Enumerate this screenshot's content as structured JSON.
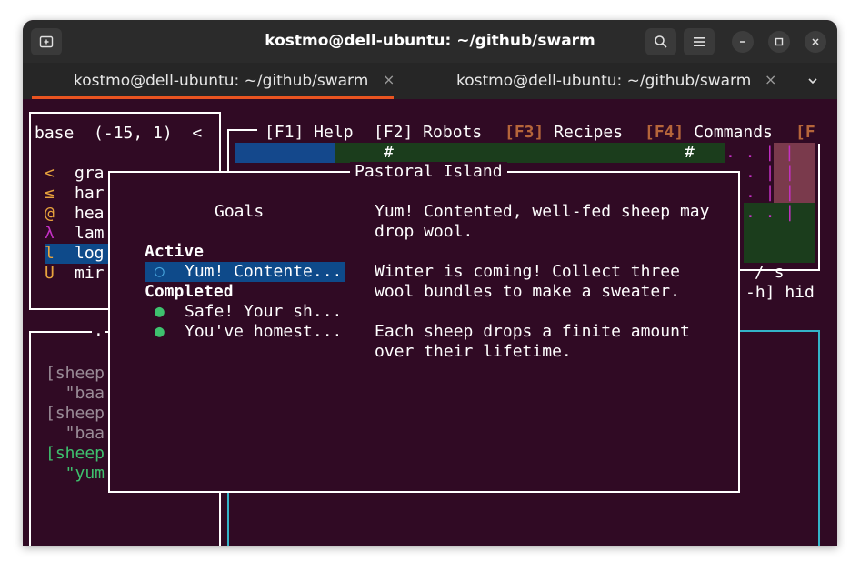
{
  "window": {
    "title": "kostmo@dell-ubuntu: ~/github/swarm"
  },
  "tabs": [
    {
      "label": "kostmo@dell-ubuntu: ~/github/swarm",
      "close": "×"
    },
    {
      "label": "kostmo@dell-ubuntu: ~/github/swarm",
      "close": "×"
    }
  ],
  "icons": {
    "new_tab": "new-tab-icon",
    "search": "search-icon",
    "menu": "hamburger-menu-icon",
    "minimize": "minimize-icon",
    "maximize": "maximize-icon",
    "close": "close-icon",
    "tabs_dropdown": "chevron-down-icon"
  },
  "robot_panel": {
    "header": "base  (-15, 1)  <",
    "inventory": [
      {
        "glyph": "<",
        "name": "gra",
        "color": "#e8a33d"
      },
      {
        "glyph": "≤",
        "name": "har",
        "color": "#e8a33d"
      },
      {
        "glyph": "@",
        "name": "hea",
        "color": "#e8a33d"
      },
      {
        "glyph": "λ",
        "name": "lam",
        "color": "#c430c4"
      },
      {
        "glyph": "l",
        "name": "log",
        "color": "#e8a33d"
      },
      {
        "glyph": "U",
        "name": "mir",
        "color": "#e8a33d"
      }
    ]
  },
  "menu_bar": [
    {
      "label": "[F1] Help",
      "dim": false
    },
    {
      "label": "[F2] Robots",
      "dim": false
    },
    {
      "key": "[F3]",
      "label": "Recipes",
      "dim": true
    },
    {
      "key": "[F4]",
      "label": "Commands",
      "dim": true
    },
    {
      "key": "[F",
      "label": "",
      "dim": true
    }
  ],
  "world": {
    "hash1": "#",
    "hash2": "#",
    "dots": [
      ". . | |",
      ". | |",
      ". | |",
      ". . |"
    ],
    "side_text_1": "/ s",
    "side_text_2": "-h] hid"
  },
  "repl": {
    "title_fragment": ".",
    "lines": [
      {
        "text": "[sheep",
        "color": "#9a8c97"
      },
      {
        "text": "  \"baa",
        "color": "#9a8c97"
      },
      {
        "text": "[sheep",
        "color": "#9a8c97"
      },
      {
        "text": "  \"baa",
        "color": "#9a8c97"
      },
      {
        "text": "[sheep",
        "color": "#3ec16e"
      },
      {
        "text": "  \"yum",
        "color": "#3ec16e"
      }
    ]
  },
  "dialog": {
    "title": "Pastoral Island",
    "goals_heading": "Goals",
    "active_heading": "Active",
    "active_goals": [
      {
        "label": "Yum! Contente...",
        "status": "○",
        "selected": true
      }
    ],
    "completed_heading": "Completed",
    "completed_goals": [
      {
        "label": "Safe! Your sh...",
        "status": "●"
      },
      {
        "label": "You've homest...",
        "status": "●"
      }
    ],
    "description": [
      "Yum! Contented, well-fed sheep may",
      "drop wool.",
      "",
      "Winter is coming! Collect three",
      "wool bundles to make a sweater.",
      "",
      "Each sheep drops a finite amount",
      "over their lifetime."
    ]
  }
}
